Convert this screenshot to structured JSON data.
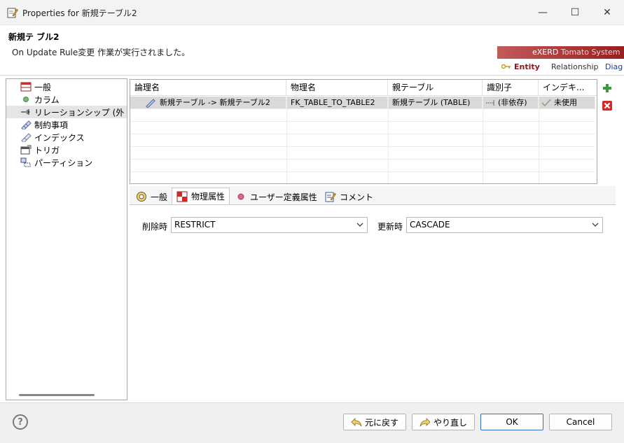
{
  "window": {
    "title": "Properties for 新規テーブル2",
    "minimize": "—",
    "maximize": "☐",
    "close": "✕"
  },
  "header": {
    "title": "新規テ ブル2",
    "message": "On Update Rule変更 作業が実行されました。",
    "banner": {
      "brand": "eXERD",
      "product": "Tomato System",
      "nav": [
        "Entity",
        "Relationship",
        "Diag"
      ]
    }
  },
  "tree": {
    "items": [
      {
        "label": "一般",
        "icon": "table-icon"
      },
      {
        "label": "カラム",
        "icon": "column-dot-icon"
      },
      {
        "label": "リレーションシップ (外",
        "icon": "relationship-arrow-icon"
      },
      {
        "label": "制約事項",
        "icon": "constraint-icon"
      },
      {
        "label": "インデックス",
        "icon": "index-icon"
      },
      {
        "label": "トリガ",
        "icon": "trigger-icon"
      },
      {
        "label": "パーティション",
        "icon": "partition-icon"
      }
    ],
    "selected_index": 2
  },
  "table": {
    "columns": [
      "論理名",
      "物理名",
      "親テーブル",
      "識別子",
      "インデキ..."
    ],
    "rows": [
      {
        "logical": "新規テーブル -> 新規テーブル2",
        "physical": "FK_TABLE_TO_TABLE2",
        "parent": "新規テーブル (TABLE)",
        "identifier": "(非依存)",
        "index": "未使用"
      }
    ]
  },
  "side_buttons": {
    "add": "add-icon",
    "remove": "remove-icon"
  },
  "tabs": [
    {
      "label": "一般",
      "icon": "general-tab-icon"
    },
    {
      "label": "物理属性",
      "icon": "physical-tab-icon"
    },
    {
      "label": "ユーザー定義属性",
      "icon": "user-attr-icon"
    },
    {
      "label": "コメント",
      "icon": "comment-icon"
    }
  ],
  "active_tab": 1,
  "form": {
    "on_delete_label": "削除時",
    "on_delete_value": "RESTRICT",
    "on_update_label": "更新時",
    "on_update_value": "CASCADE"
  },
  "footer": {
    "help": "?",
    "undo": "元に戻す",
    "redo": "やり直し",
    "ok": "OK",
    "cancel": "Cancel"
  }
}
